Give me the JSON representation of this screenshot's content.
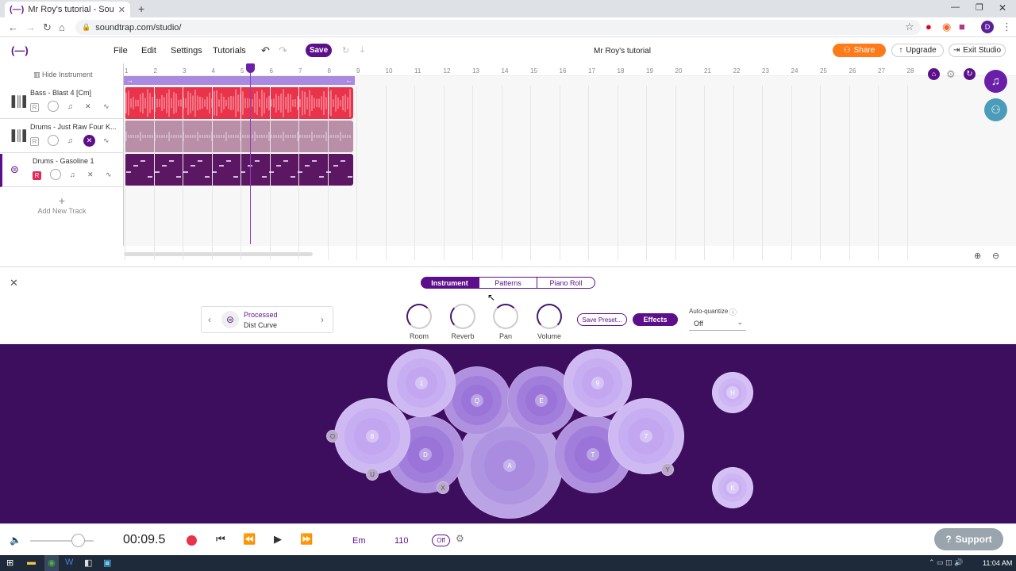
{
  "browser": {
    "tab_title": "Mr Roy's tutorial - Soundtrap",
    "url": "soundtrap.com/studio/",
    "profile_initial": "D"
  },
  "app": {
    "menu": [
      "File",
      "Edit",
      "Settings",
      "Tutorials"
    ],
    "save_label": "Save",
    "project_title": "Mr Roy's tutorial",
    "share_label": "Share",
    "upgrade_label": "Upgrade",
    "exit_label": "Exit Studio",
    "hide_instrument": "Hide Instrument",
    "add_track": "Add New Track"
  },
  "tracks": [
    {
      "name": "Bass - Blast 4 [Cm]",
      "color": "#e8334a"
    },
    {
      "name": "Drums - Just Raw Four K...",
      "color": "#b98fa8"
    },
    {
      "name": "Drums - Gasoline 1",
      "color": "#5c1763"
    }
  ],
  "ruler": [
    "1",
    "2",
    "3",
    "4",
    "5",
    "6",
    "7",
    "8",
    "9",
    "10",
    "11",
    "12",
    "13",
    "14",
    "15",
    "16",
    "17",
    "18",
    "19",
    "20",
    "21",
    "22",
    "23",
    "24",
    "25",
    "26",
    "27",
    "28"
  ],
  "panel": {
    "tabs": [
      "Instrument",
      "Patterns",
      "Piano Roll"
    ],
    "preset_name": "Processed",
    "preset_sub": "Dist Curve",
    "knobs": [
      "Room",
      "Reverb",
      "Pan",
      "Volume"
    ],
    "save_preset": "Save Preset...",
    "effects": "Effects",
    "autoquantize_label": "Auto-quantize",
    "autoquantize_value": "Off"
  },
  "pads": [
    "1",
    "Q",
    "E",
    "9",
    "H",
    "8",
    "D",
    "A",
    "T",
    "7",
    "K",
    "O",
    "U",
    "X",
    "Y"
  ],
  "transport": {
    "time": "00:09.5",
    "key": "Em",
    "tempo": "110",
    "metronome": "Off",
    "support": "Support"
  },
  "taskbar": {
    "clock": "11:04 AM"
  },
  "colors": {
    "accent": "#5c0f8b",
    "share": "#ff7a1a",
    "pad_bg": "#3e0e5e"
  }
}
